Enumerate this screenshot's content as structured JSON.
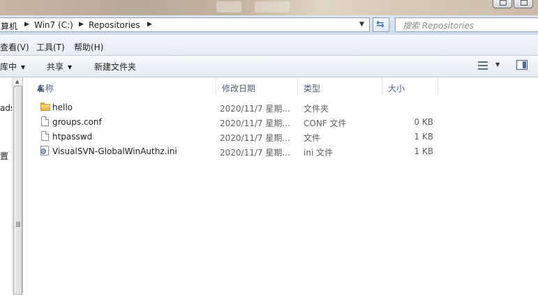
{
  "address_bar": {
    "crumbs": [
      "算机",
      "Win7 (C:)",
      "Repositories"
    ],
    "search_placeholder": "搜索 Repositories"
  },
  "menu": [
    "查看(V)",
    "工具(T)",
    "帮助(H)"
  ],
  "commands": {
    "include_in_library": "库中",
    "share": "共享",
    "new_folder": "新建文件夹"
  },
  "nav_pane": {
    "items": [
      "ads",
      "置"
    ]
  },
  "columns": {
    "name": "名称",
    "modified": "修改日期",
    "type": "类型",
    "size": "大小"
  },
  "files": [
    {
      "name": "hello",
      "modified": "2020/11/7 星期...",
      "type": "文件夹",
      "size": "",
      "icon": "folder-icon"
    },
    {
      "name": "groups.conf",
      "modified": "2020/11/7 星期...",
      "type": "CONF 文件",
      "size": "0 KB",
      "icon": "file-icon"
    },
    {
      "name": "htpasswd",
      "modified": "2020/11/7 星期...",
      "type": "文件",
      "size": "1 KB",
      "icon": "file-icon"
    },
    {
      "name": "VisualSVN-GlobalWinAuthz.ini",
      "modified": "2020/11/7 星期...",
      "type": "ini 文件",
      "size": "1 KB",
      "icon": "ini-file-icon"
    }
  ]
}
